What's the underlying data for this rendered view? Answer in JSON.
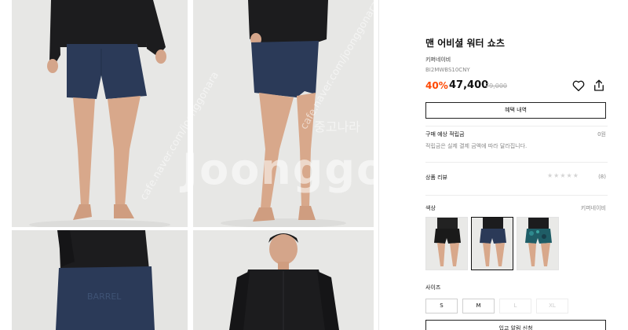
{
  "product": {
    "title": "맨 어비셜 워터 쇼츠",
    "brand": "키퍼네이비",
    "code": "BI2MWBS10CNY",
    "discount": "40%",
    "price": "47,400",
    "original_price": "79,000"
  },
  "benefit_button_label": "혜택 내역",
  "points": {
    "label": "구매 예상 적립금",
    "value": "0원",
    "note": "적립금은 실제 결제 금액에 따라 달라집니다."
  },
  "review": {
    "label": "상품 리뷰",
    "stars": "★★★★★",
    "rating_value": 0,
    "count": "(8)"
  },
  "color": {
    "label": "색상",
    "selected_value": "키퍼네이비",
    "swatches": [
      {
        "name": "black",
        "selected": false
      },
      {
        "name": "navy",
        "selected": true
      },
      {
        "name": "camo",
        "selected": false
      }
    ]
  },
  "size": {
    "label": "사이즈",
    "options": [
      {
        "label": "S",
        "available": true
      },
      {
        "label": "M",
        "available": true
      },
      {
        "label": "L",
        "available": false
      },
      {
        "label": "XL",
        "available": false
      }
    ]
  },
  "notify_button_label": "입고 알림 신청",
  "watermark": {
    "logo": "Joonggonara",
    "url": "cafe.naver.com/joonggonara",
    "korean": "중고나라"
  },
  "icons": {
    "wishlist": "heart-icon",
    "share": "share-icon"
  },
  "colors": {
    "discount": "#ff4800",
    "shorts_navy": "#2b3a58",
    "background": "#e6e6e4"
  }
}
